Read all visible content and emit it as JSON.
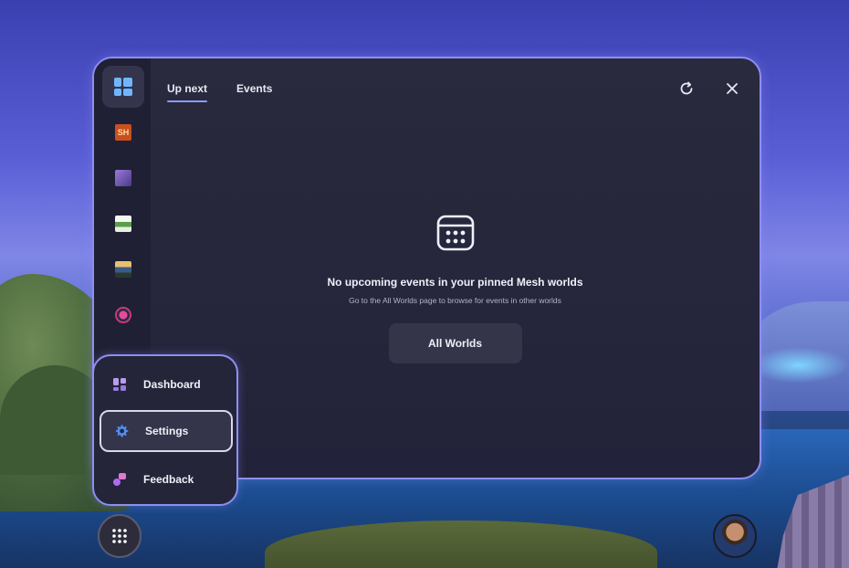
{
  "tabs": [
    {
      "label": "Up next",
      "active": true
    },
    {
      "label": "Events",
      "active": false
    }
  ],
  "rail": {
    "items": [
      {
        "name": "rail-dashboard",
        "active": true
      },
      {
        "name": "rail-world-sh",
        "text": "SH",
        "color": "#c8501e"
      },
      {
        "name": "rail-world-purple",
        "color": "#7a5cc0"
      },
      {
        "name": "rail-world-green",
        "color": "#e8f0e0"
      },
      {
        "name": "rail-world-landscape",
        "color": "#3a5a8a"
      },
      {
        "name": "rail-world-circle",
        "color": "#c83a7a"
      }
    ]
  },
  "empty_state": {
    "icon": "calendar-icon",
    "title": "No upcoming events in your pinned Mesh worlds",
    "subtitle": "Go to the All Worlds page to browse for events in other worlds",
    "button_label": "All Worlds"
  },
  "menu": {
    "items": [
      {
        "label": "Dashboard",
        "icon": "dashboard-icon"
      },
      {
        "label": "Settings",
        "icon": "gear-icon",
        "selected": true
      },
      {
        "label": "Feedback",
        "icon": "feedback-icon"
      }
    ]
  },
  "colors": {
    "accent": "#8d8ff0",
    "panel": "#22223a",
    "tab_underline": "#8a9cff",
    "dashboard_icon": "#6fb6ff"
  }
}
